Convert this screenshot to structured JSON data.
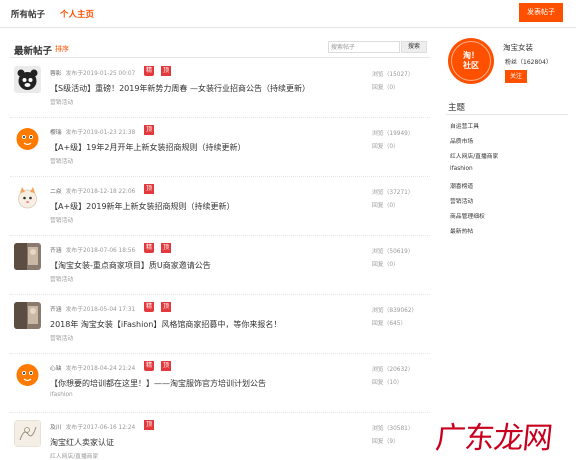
{
  "nav": {
    "all_posts": "所有帖子",
    "personal_page": "个人主页",
    "post_button": "发表帖子"
  },
  "main": {
    "heading": "最新帖子",
    "sort": "排序",
    "search_placeholder": "搜索帖子",
    "search_button": "搜索"
  },
  "posts": [
    {
      "author": "蓉影",
      "posted": "发布于2019-01-25 00:07",
      "tags": [
        "精",
        "顶"
      ],
      "title": "【S级活动】重磅！2019年新势力周春 —女装行业招商公告（持续更新）",
      "category": "营销活动",
      "views": "浏览（15027）",
      "replies": "回复（0）",
      "avatar_icon": "bear-avatar-icon"
    },
    {
      "author": "樱瑞",
      "posted": "发布于2019-01-23 21:38",
      "tags": [
        "顶"
      ],
      "title": "【A+级】19年2月开年上新女装招商规则（持续更新）",
      "category": "营销活动",
      "views": "浏览（19949）",
      "replies": "回复（0）",
      "avatar_icon": "taobao-mascot-avatar-icon"
    },
    {
      "author": "二焱",
      "posted": "发布于2018-12-18 22:06",
      "tags": [
        "顶"
      ],
      "title": "【A+级】2019新年上新女装招商规则（持续更新）",
      "category": "营销活动",
      "views": "浏览（37271）",
      "replies": "回复（0）",
      "avatar_icon": "cartoon-cat-avatar-icon"
    },
    {
      "author": "齐涵",
      "posted": "发布于2018-07-06 18:56",
      "tags": [
        "精",
        "顶"
      ],
      "title": "【淘宝女装-重点商家项目】质U商家邀请公告",
      "category": "营销活动",
      "views": "浏览（50619）",
      "replies": "回复（0）",
      "avatar_icon": "photo-avatar-icon"
    },
    {
      "author": "齐涵",
      "posted": "发布于2018-05-04 17:31",
      "tags": [
        "精",
        "顶"
      ],
      "title": "2018年 淘宝女装【iFashion】风格馆商家招募中，等你来报名！",
      "category": "营销活动",
      "views": "浏览（839062）",
      "replies": "回复（645）",
      "avatar_icon": "photo-avatar-icon"
    },
    {
      "author": "心缺",
      "posted": "发布于2018-04-24 21:24",
      "tags": [
        "精",
        "顶"
      ],
      "title": "【你想要的培训都在这里！】——淘宝服饰官方培训计划公告",
      "category": "ifashion",
      "views": "浏览（20632）",
      "replies": "回复（10）",
      "avatar_icon": "taobao-mascot-avatar-icon"
    },
    {
      "author": "及川",
      "posted": "发布于2017-06-16 12:24",
      "tags": [
        "顶"
      ],
      "title": "淘宝红人卖家认证",
      "category": "红人网店/直播商家",
      "views": "浏览（30581）",
      "replies": "回复（9）",
      "avatar_icon": "sketch-avatar-icon"
    }
  ],
  "sidebar": {
    "logo_line1": "淘！",
    "logo_line2": "社区",
    "brand_name": "淘宝女装",
    "fans": "粉丝（162804）",
    "follow_button": "关注",
    "topics_heading": "主题",
    "topics": [
      "自运营工具",
      "品质市场",
      "红人网店/直播商家",
      "ifashion",
      "潮喜榜道",
      "营销活动",
      "商品管理细权",
      "最新热帖"
    ]
  },
  "watermark": "广东龙网",
  "colors": {
    "accent": "#ff5000",
    "tag_red": "#e4393c",
    "watermark_red": "#c8001e"
  }
}
